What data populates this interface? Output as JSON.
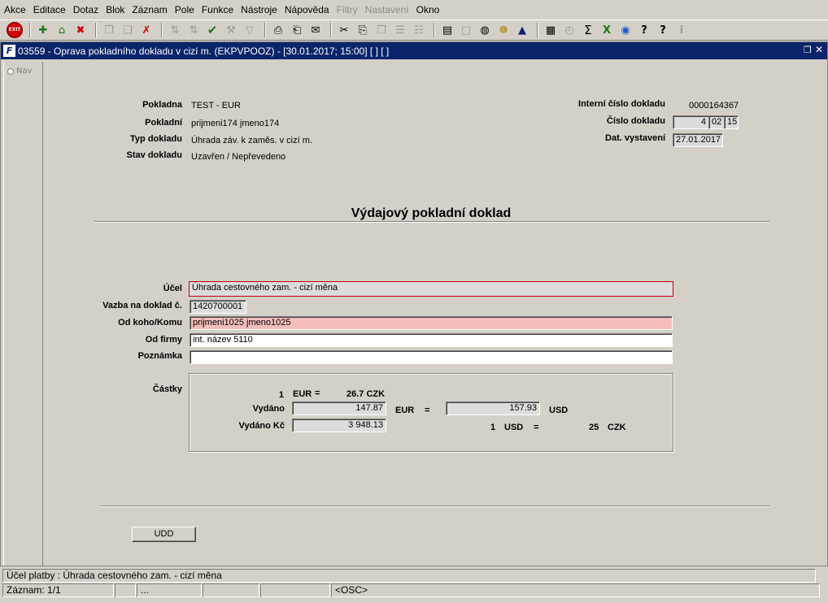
{
  "menu": [
    "Akce",
    "Editace",
    "Dotaz",
    "Blok",
    "Záznam",
    "Pole",
    "Funkce",
    "Nástroje",
    "Nápověda",
    "Filtry",
    "Nastavení",
    "Okno"
  ],
  "menu_disabled": [
    "Filtry",
    "Nastavení"
  ],
  "toolbar": {
    "exit_label": "EXIT",
    "icons": [
      "exit-icon",
      "insert-record-icon",
      "save-record-icon",
      "delete-record-icon",
      "copy-record-icon",
      "paste-record-icon",
      "clear-record-icon",
      "sort-asc-icon",
      "sort-desc-icon",
      "accept-icon",
      "query-icon",
      "filter-icon",
      "print-icon",
      "print-preview-icon",
      "mail-icon",
      "cut-icon",
      "copy-icon",
      "paste-icon",
      "list-icon",
      "tree-icon",
      "report-icon",
      "document-icon",
      "globe-icon",
      "settings-icon",
      "pyramid-icon",
      "chart-icon",
      "clock-icon",
      "sum-icon",
      "excel-icon",
      "web-icon",
      "help-cursor-icon",
      "help-icon",
      "info-icon"
    ]
  },
  "window": {
    "title": "03559 - Oprava pokladního dokladu v cizí m. (EKPVPOOZ) - [30.01.2017; 15:00]  [ ]  [ ]",
    "nav_label": "Nav"
  },
  "form": {
    "pokladna_label": "Pokladna",
    "pokladna_value": "TEST - EUR",
    "pokladni_label": "Pokladní",
    "pokladni_value": "prijmeni174 jmeno174",
    "typ_label": "Typ dokladu",
    "typ_value": "Úhrada záv. k zaměs. v cizí m.",
    "stav_label": "Stav dokladu",
    "stav_value": "Uzavřen / Nepřevedeno",
    "interni_label": "Interní číslo dokladu",
    "interni_value": "0000164367",
    "cislo_label": "Číslo dokladu",
    "cislo_part1": "4",
    "cislo_part2": "02",
    "cislo_part3": "15",
    "dat_label": "Dat. vystavení",
    "dat_value": "27.01.2017",
    "heading": "Výdajový pokladní doklad",
    "ucel_label": "Účel",
    "ucel_value": "Úhrada cestovného zam. - cizí měna",
    "vazba_label": "Vazba na doklad č.",
    "vazba_value": "1420700001",
    "odkoho_label": "Od koho/Komu",
    "odkoho_value": "prijmeni1025 jmeno1025",
    "odfirmy_label": "Od firmy",
    "odfirmy_value": "int. název 5110",
    "poznamka_label": "Poznámka",
    "poznamka_value": "",
    "castky_label": "Částky",
    "rate_amount": "1",
    "rate_cur": "EUR",
    "rate_eq": "=",
    "rate_value": "26.7 CZK",
    "vydano_label": "Vydáno",
    "vydano_value": "147.87",
    "vydano_cur": "EUR",
    "vydano_eq": "=",
    "vydano_usd_value": "157.93",
    "vydano_usd_cur": "USD",
    "vydano_kc_label": "Vydáno Kč",
    "vydano_kc_value": "3 948.13",
    "usd_amount": "1",
    "usd_cur": "USD",
    "usd_eq": "=",
    "usd_value": "25",
    "usd_czk": "CZK",
    "udd_button": "UDD"
  },
  "status": {
    "line1": "Účel platby : Úhrada cestovného zam. - cizí měna",
    "record": "Záznam: 1/1",
    "cell3": "...",
    "osc": "<OSC>"
  }
}
